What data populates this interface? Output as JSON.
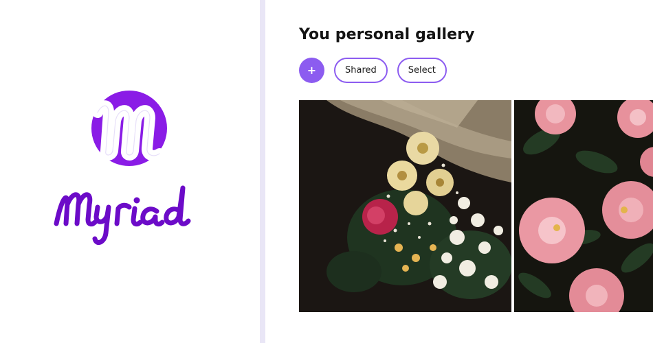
{
  "brand": {
    "logo_letter": "m",
    "name": "Myriad",
    "colors": {
      "primary": "#8a1ce6",
      "wordmark": "#6c0bc8"
    }
  },
  "gallery": {
    "title": "You personal gallery",
    "add_button": {
      "icon": "plus-icon",
      "label": "+"
    },
    "filters": [
      {
        "label": "Shared"
      },
      {
        "label": "Select"
      }
    ],
    "photos": [
      {
        "subject": "bouquet of white and yellow flowers on dark background"
      },
      {
        "subject": "pink camellia flowers with dark green leaves"
      }
    ]
  },
  "theme": {
    "accent": "#8c5cf0",
    "divider": "#e9e6f6"
  }
}
